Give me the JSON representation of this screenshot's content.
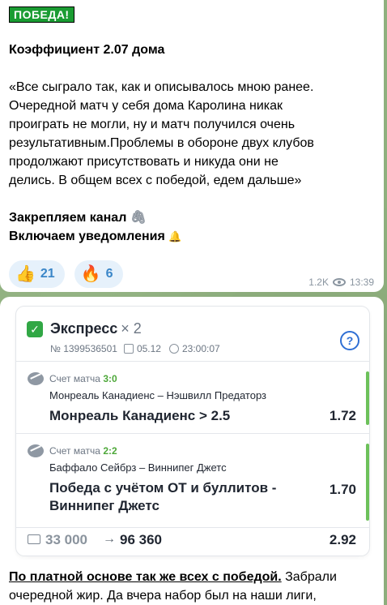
{
  "post1": {
    "badge": "ПОБЕДА!",
    "coef_line": "Коэффициент 2.07 дома",
    "quote_lines": [
      "«Все сыграло так, как и описывалось мною ранее.",
      "Очередной матч у себя дома Каролина никак",
      "проиграть не могли, ну и матч получился очень",
      "результативным.Проблемы в обороне двух клубов",
      "продолжают присутствовать и никуда они не",
      "делись. В общем всех с победой, едем дальше»"
    ],
    "pin_line": "Закрепляем канал",
    "notify_line": "Включаем уведомления",
    "reactions": [
      {
        "emoji": "👍",
        "count": "21"
      },
      {
        "emoji": "🔥",
        "count": "6"
      }
    ],
    "views": "1.2K",
    "time": "13:39"
  },
  "ticket": {
    "title": "Экспресс",
    "multiplier": "× 2",
    "number": "№ 1399536501",
    "date": "05.12",
    "time": "23:00:07",
    "help": "?",
    "events": [
      {
        "score_label": "Счет матча",
        "score": "3:0",
        "teams": "Монреаль Канадиенс – Нэшвилл Предаторз",
        "pick": "Монреаль Канадиенс > 2.5",
        "odd": "1.72"
      },
      {
        "score_label": "Счет матча",
        "score": "2:2",
        "teams": "Баффало Сейбрз – Виннипег Джетс",
        "pick": "Победа с учётом ОТ и буллитов - Виннипег Джетс",
        "odd": "1.70"
      }
    ],
    "stake": "33 000",
    "arrow": "→",
    "win": "96 360",
    "total_odd": "2.92"
  },
  "post2": {
    "line1_bold": "По платной основе так же всех с победой.",
    "line1_rest": " Забрали",
    "line2": "очередной жир. Да вчера набор был на наши лиги,"
  },
  "colors": {
    "win_badge": "#1a9c32",
    "reaction_text": "#3a86c8",
    "score_green": "#4ea83a",
    "accent_blue": "#2f6fd4"
  }
}
